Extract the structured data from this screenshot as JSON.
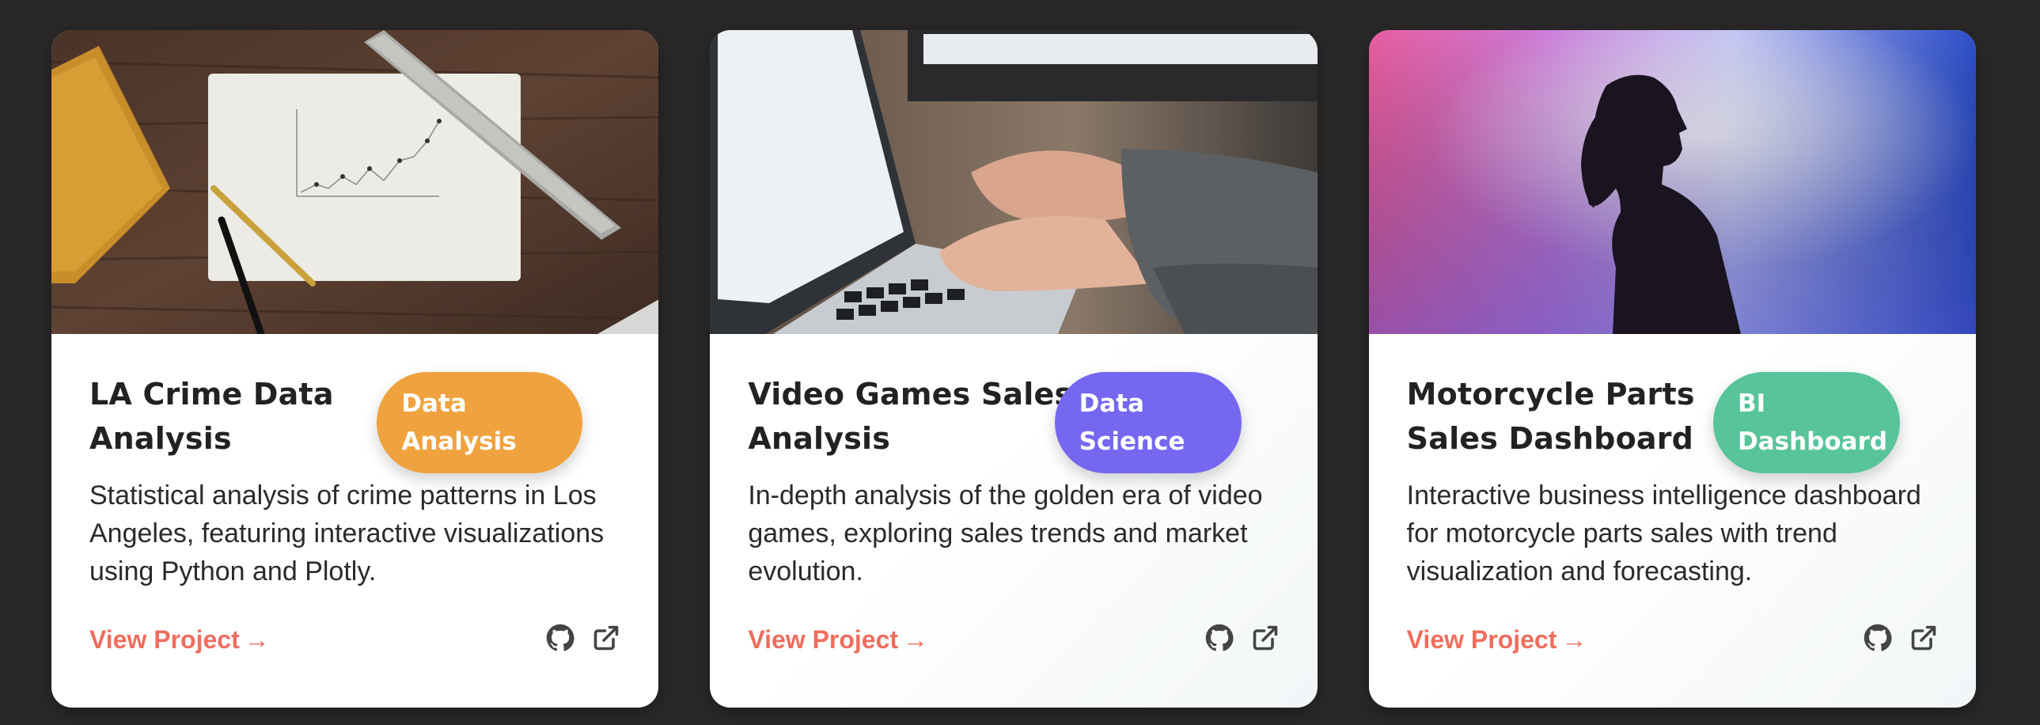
{
  "projects": [
    {
      "title": "LA Crime Data Analysis",
      "badge": "Data Analysis",
      "badge_color": "#f0a23e",
      "description": "Statistical analysis of crime patterns in Los Angeles, featuring interactive visualizations using Python and Plotly.",
      "link_label": "View Project",
      "image": "desk-with-chart-paper-and-ruler"
    },
    {
      "title": "Video Games Sales Analysis",
      "badge": "Data Science",
      "badge_color": "#7567f0",
      "description": "In-depth analysis of the golden era of video games, exploring sales trends and market evolution.",
      "link_label": "View Project",
      "image": "hands-typing-on-laptop"
    },
    {
      "title": "Motorcycle Parts Sales Dashboard",
      "badge": "BI Dashboard",
      "badge_color": "#57c49a",
      "description": "Interactive business intelligence dashboard for motorcycle parts sales with trend visualization and forecasting.",
      "link_label": "View Project",
      "image": "silhouette-on-gradient-background"
    }
  ],
  "icons": {
    "repo": "github-icon",
    "external": "external-link-icon",
    "link_arrow": "→"
  }
}
